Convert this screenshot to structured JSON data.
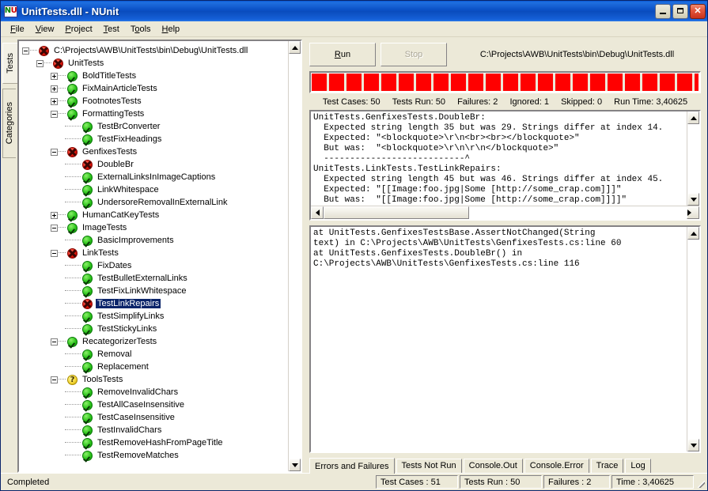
{
  "window": {
    "title": "UnitTests.dll - NUnit",
    "icon": "nunit-logo-icon",
    "minimize_label": "_",
    "maximize_label": "□",
    "close_label": "✕"
  },
  "menu": {
    "items": [
      {
        "label": "File"
      },
      {
        "label": "View"
      },
      {
        "label": "Project"
      },
      {
        "label": "Test"
      },
      {
        "label": "Tools"
      },
      {
        "label": "Help"
      }
    ]
  },
  "left_tabs": [
    {
      "label": "Tests",
      "active": true
    },
    {
      "label": "Categories",
      "active": false
    }
  ],
  "tree": {
    "nodes": [
      {
        "label": "C:\\Projects\\AWB\\UnitTests\\bin\\Debug\\UnitTests.dll",
        "status": "fail",
        "depth": 0,
        "expander": "minus"
      },
      {
        "label": "UnitTests",
        "status": "fail",
        "depth": 1,
        "expander": "minus"
      },
      {
        "label": "BoldTitleTests",
        "status": "pass",
        "depth": 2,
        "expander": "plus"
      },
      {
        "label": "FixMainArticleTests",
        "status": "pass",
        "depth": 2,
        "expander": "plus"
      },
      {
        "label": "FootnotesTests",
        "status": "pass",
        "depth": 2,
        "expander": "plus"
      },
      {
        "label": "FormattingTests",
        "status": "pass",
        "depth": 2,
        "expander": "minus"
      },
      {
        "label": "TestBrConverter",
        "status": "pass",
        "depth": 3,
        "expander": "none"
      },
      {
        "label": "TestFixHeadings",
        "status": "pass",
        "depth": 3,
        "expander": "none"
      },
      {
        "label": "GenfixesTests",
        "status": "fail",
        "depth": 2,
        "expander": "minus"
      },
      {
        "label": "DoubleBr",
        "status": "fail",
        "depth": 3,
        "expander": "none"
      },
      {
        "label": "ExternalLinksInImageCaptions",
        "status": "pass",
        "depth": 3,
        "expander": "none"
      },
      {
        "label": "LinkWhitespace",
        "status": "pass",
        "depth": 3,
        "expander": "none"
      },
      {
        "label": "UndersoreRemovalInExternalLink",
        "status": "pass",
        "depth": 3,
        "expander": "none"
      },
      {
        "label": "HumanCatKeyTests",
        "status": "pass",
        "depth": 2,
        "expander": "plus"
      },
      {
        "label": "ImageTests",
        "status": "pass",
        "depth": 2,
        "expander": "minus"
      },
      {
        "label": "BasicImprovements",
        "status": "pass",
        "depth": 3,
        "expander": "none"
      },
      {
        "label": "LinkTests",
        "status": "fail",
        "depth": 2,
        "expander": "minus"
      },
      {
        "label": "FixDates",
        "status": "pass",
        "depth": 3,
        "expander": "none"
      },
      {
        "label": "TestBulletExternalLinks",
        "status": "pass",
        "depth": 3,
        "expander": "none"
      },
      {
        "label": "TestFixLinkWhitespace",
        "status": "pass",
        "depth": 3,
        "expander": "none"
      },
      {
        "label": "TestLinkRepairs",
        "status": "fail",
        "depth": 3,
        "expander": "none",
        "selected": true
      },
      {
        "label": "TestSimplifyLinks",
        "status": "pass",
        "depth": 3,
        "expander": "none"
      },
      {
        "label": "TestStickyLinks",
        "status": "pass",
        "depth": 3,
        "expander": "none"
      },
      {
        "label": "RecategorizerTests",
        "status": "pass",
        "depth": 2,
        "expander": "minus"
      },
      {
        "label": "Removal",
        "status": "pass",
        "depth": 3,
        "expander": "none"
      },
      {
        "label": "Replacement",
        "status": "pass",
        "depth": 3,
        "expander": "none"
      },
      {
        "label": "ToolsTests",
        "status": "ignored",
        "depth": 2,
        "expander": "minus"
      },
      {
        "label": "RemoveInvalidChars",
        "status": "pass",
        "depth": 3,
        "expander": "none"
      },
      {
        "label": "TestAllCaseInsensitive",
        "status": "pass",
        "depth": 3,
        "expander": "none"
      },
      {
        "label": "TestCaseInsensitive",
        "status": "pass",
        "depth": 3,
        "expander": "none"
      },
      {
        "label": "TestInvalidChars",
        "status": "pass",
        "depth": 3,
        "expander": "none"
      },
      {
        "label": "TestRemoveHashFromPageTitle",
        "status": "pass",
        "depth": 3,
        "expander": "none"
      },
      {
        "label": "TestRemoveMatches",
        "status": "pass",
        "depth": 3,
        "expander": "none"
      }
    ],
    "ignored_glyph": "?"
  },
  "runner": {
    "run_label": "Run",
    "stop_label": "Stop",
    "assembly_path": "C:\\Projects\\AWB\\UnitTests\\bin\\Debug\\UnitTests.dll",
    "progress_color": "#ff0000",
    "progress_percent": 100
  },
  "stats": {
    "test_cases": "Test Cases: 50",
    "tests_run": "Tests Run: 50",
    "failures": "Failures: 2",
    "ignored": "Ignored: 1",
    "skipped": "Skipped: 0",
    "run_time": "Run Time: 3,40625"
  },
  "errors_panel": {
    "text": "UnitTests.GenfixesTests.DoubleBr:\n  Expected string length 35 but was 29. Strings differ at index 14.\n  Expected: \"<blockquote>\\r\\n<br><br></blockquote>\"\n  But was:  \"<blockquote>\\r\\n\\r\\n</blockquote>\"\n  ---------------------------^\nUnitTests.LinkTests.TestLinkRepairs:\n  Expected string length 45 but was 46. Strings differ at index 45.\n  Expected: \"[[Image:foo.jpg|Some [http://some_crap.com]]]\"\n  But was:  \"[[Image:foo.jpg|Some [http://some_crap.com]]]]\"\n  --------------------------------------------^"
  },
  "trace_panel": {
    "text": "at UnitTests.GenfixesTestsBase.AssertNotChanged(String\ntext) in C:\\Projects\\AWB\\UnitTests\\GenfixesTests.cs:line 60\nat UnitTests.GenfixesTests.DoubleBr() in\nC:\\Projects\\AWB\\UnitTests\\GenfixesTests.cs:line 116"
  },
  "bottom_tabs": [
    {
      "label": "Errors and Failures",
      "active": true
    },
    {
      "label": "Tests Not Run",
      "active": false
    },
    {
      "label": "Console.Out",
      "active": false
    },
    {
      "label": "Console.Error",
      "active": false
    },
    {
      "label": "Trace",
      "active": false
    },
    {
      "label": "Log",
      "active": false
    }
  ],
  "statusbar": {
    "message": "Completed",
    "test_cases": "Test Cases : 51",
    "tests_run": "Tests Run : 50",
    "failures": "Failures : 2",
    "time": "Time : 3,40625"
  }
}
